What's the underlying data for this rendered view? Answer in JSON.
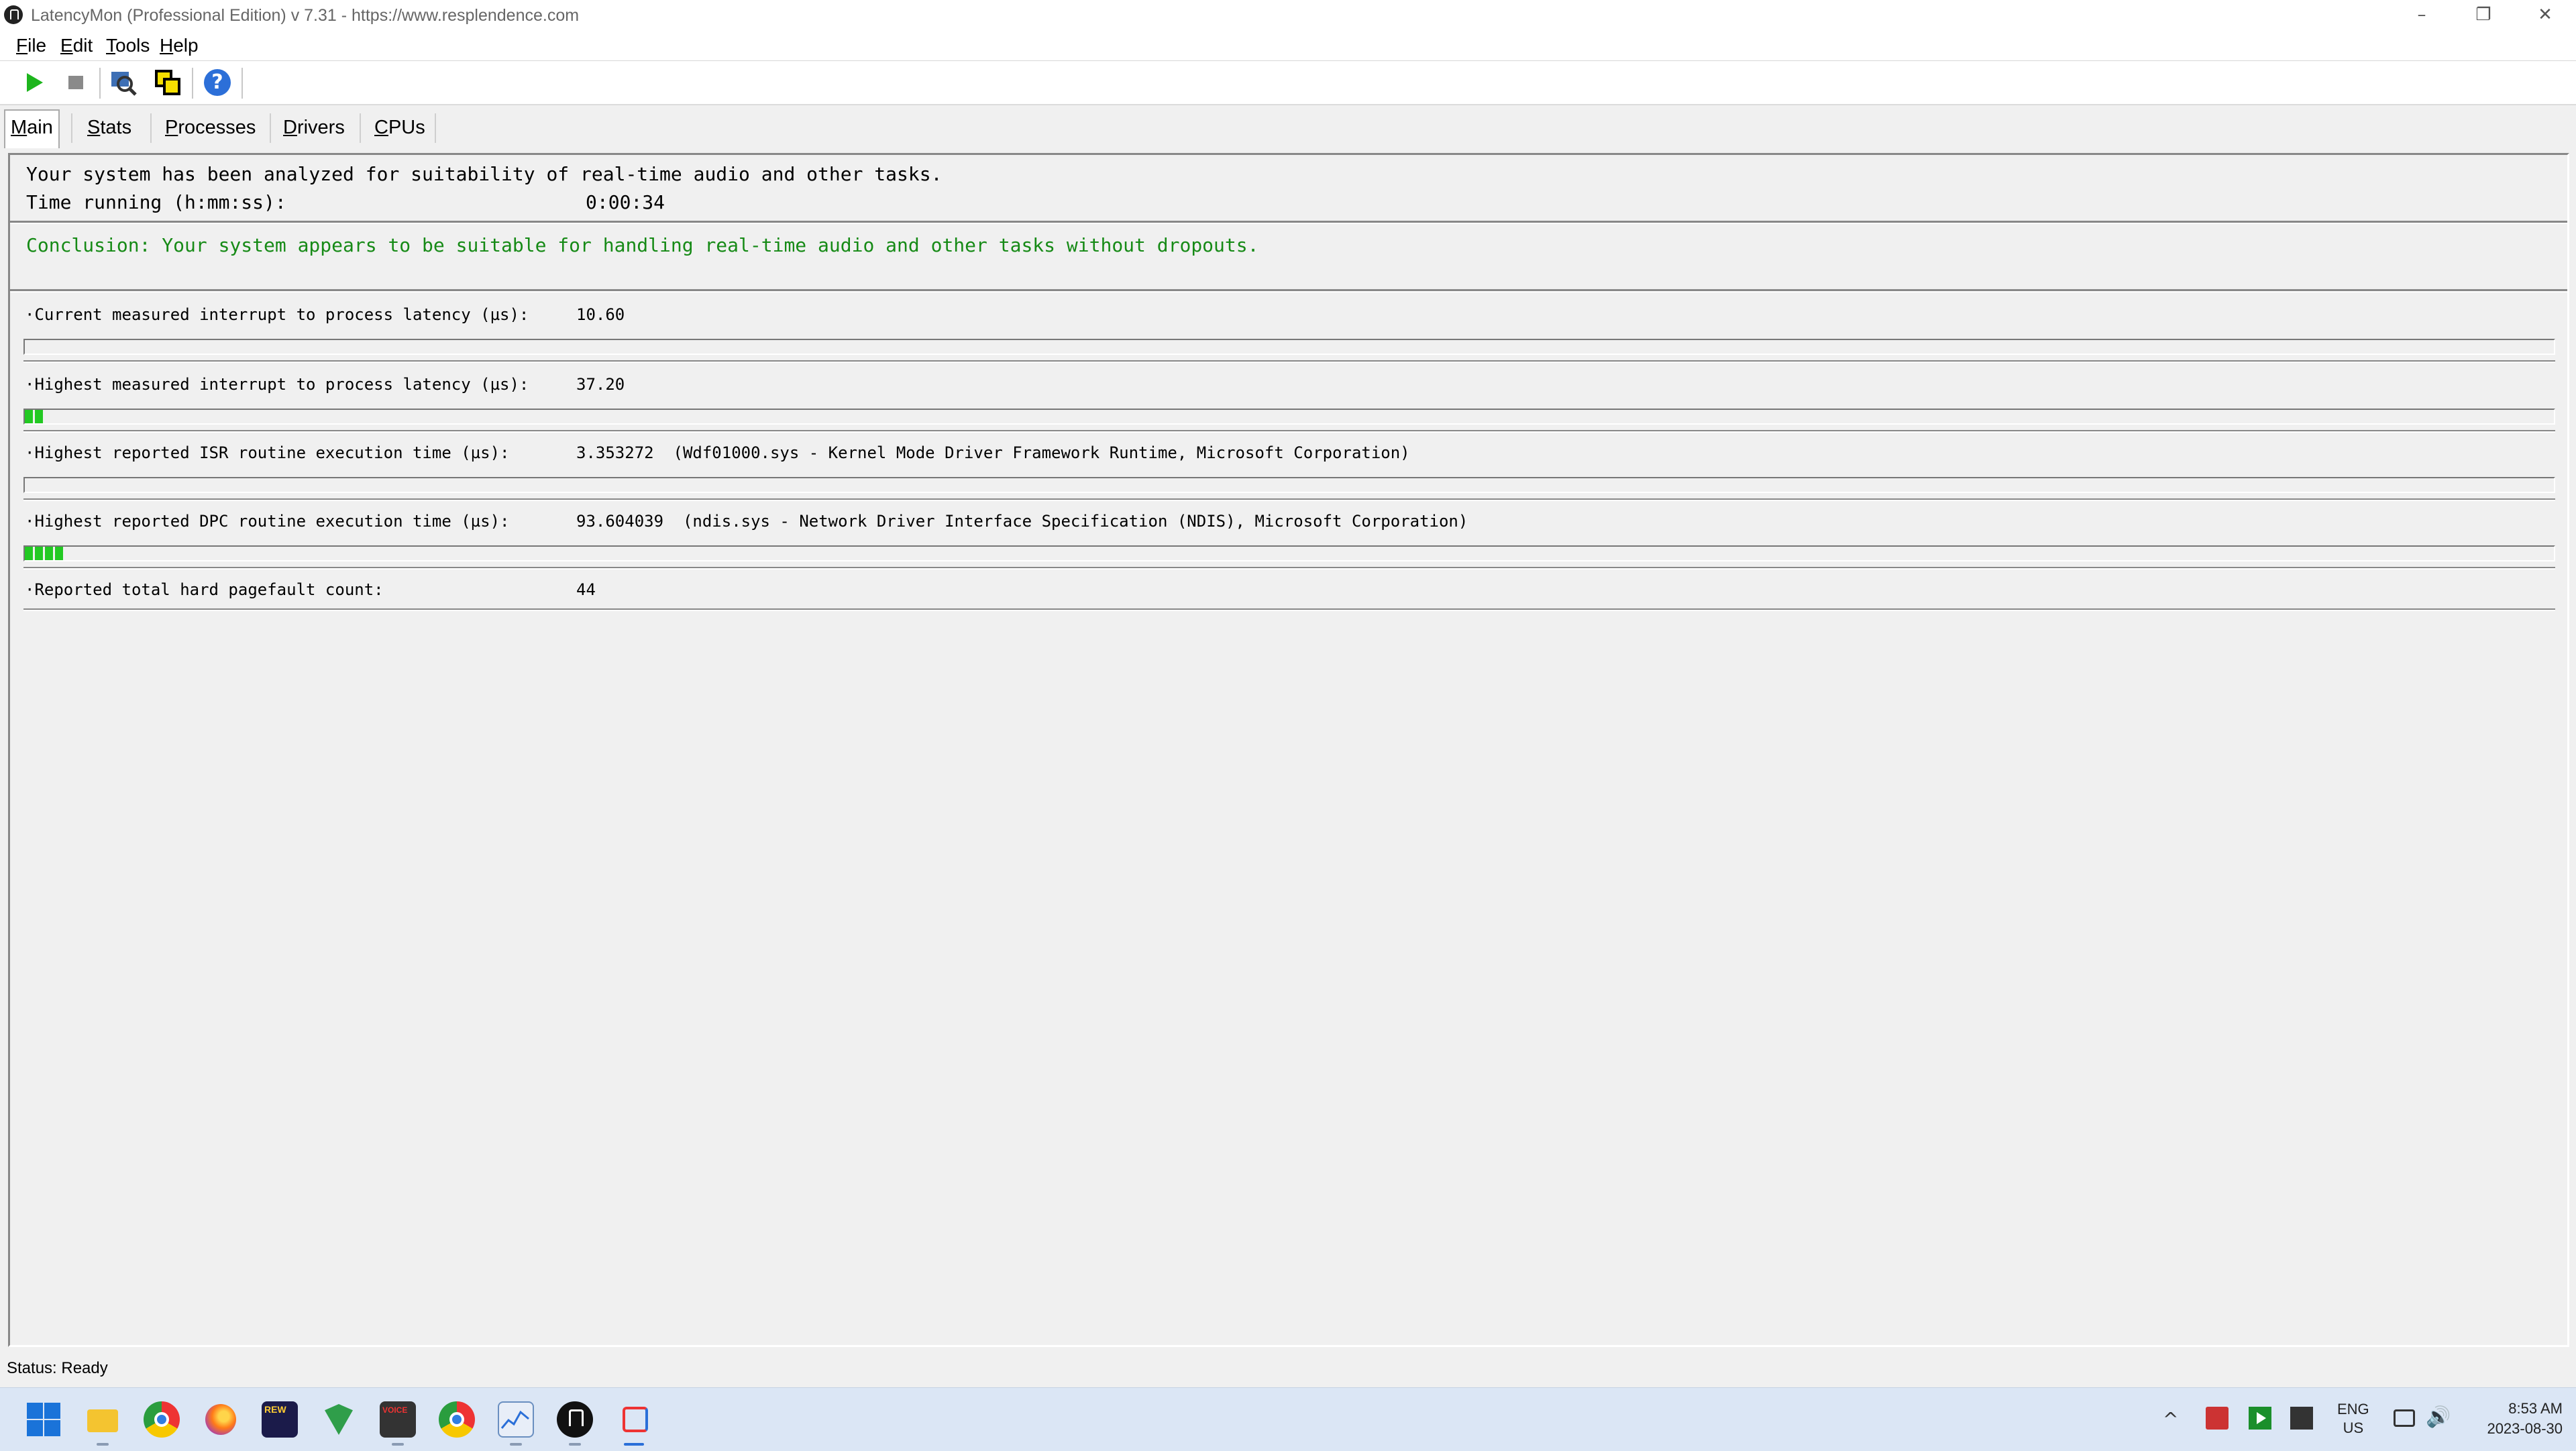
{
  "window": {
    "title": "LatencyMon  (Professional Edition)  v 7.31 - https://www.resplendence.com",
    "min": "–",
    "max": "❐",
    "close": "✕"
  },
  "menu": [
    {
      "accel": "F",
      "rest": "ile"
    },
    {
      "accel": "E",
      "rest": "dit"
    },
    {
      "accel": "T",
      "rest": "ools"
    },
    {
      "accel": "H",
      "rest": "elp"
    }
  ],
  "tabs": [
    {
      "accel": "M",
      "rest": "ain"
    },
    {
      "accel": "S",
      "rest": "tats"
    },
    {
      "accel": "P",
      "rest": "rocesses"
    },
    {
      "accel": "D",
      "rest": "rivers"
    },
    {
      "accel": "C",
      "rest": "PUs"
    }
  ],
  "main": {
    "analysis": "Your system has been analyzed for suitability of real-time audio and other tasks.",
    "time_label": "Time running (h:mm:ss):",
    "time_value": "0:00:34",
    "conclusion": "Conclusion: Your system appears to be suitable for handling real-time audio and other tasks without dropouts.",
    "conclusion_color": "#168a16",
    "metrics": [
      {
        "label": "·Current measured interrupt to process latency (µs):",
        "value": "10.60",
        "segments": 0
      },
      {
        "label": "·Highest measured interrupt to process latency (µs):",
        "value": "37.20",
        "segments": 2
      },
      {
        "label": "·Highest reported ISR routine execution time (µs):",
        "value": "3.353272  (Wdf01000.sys - Kernel Mode Driver Framework Runtime, Microsoft Corporation)",
        "segments": 0
      },
      {
        "label": "·Highest reported DPC routine execution time (µs):",
        "value": "93.604039  (ndis.sys - Network Driver Interface Specification (NDIS), Microsoft Corporation)",
        "segments": 4
      },
      {
        "label": "·Reported total hard pagefault count:",
        "value": "44"
      }
    ],
    "bar_color": "#22c922"
  },
  "status": "Status: Ready",
  "taskbar": {
    "rew_label": "REW",
    "voicemeeter_label": "VOICE",
    "lang_line1": "ENG",
    "lang_line2": "US",
    "time": "8:53 AM",
    "date": "2023-08-30",
    "chevron": "^",
    "volume": "🔊"
  }
}
